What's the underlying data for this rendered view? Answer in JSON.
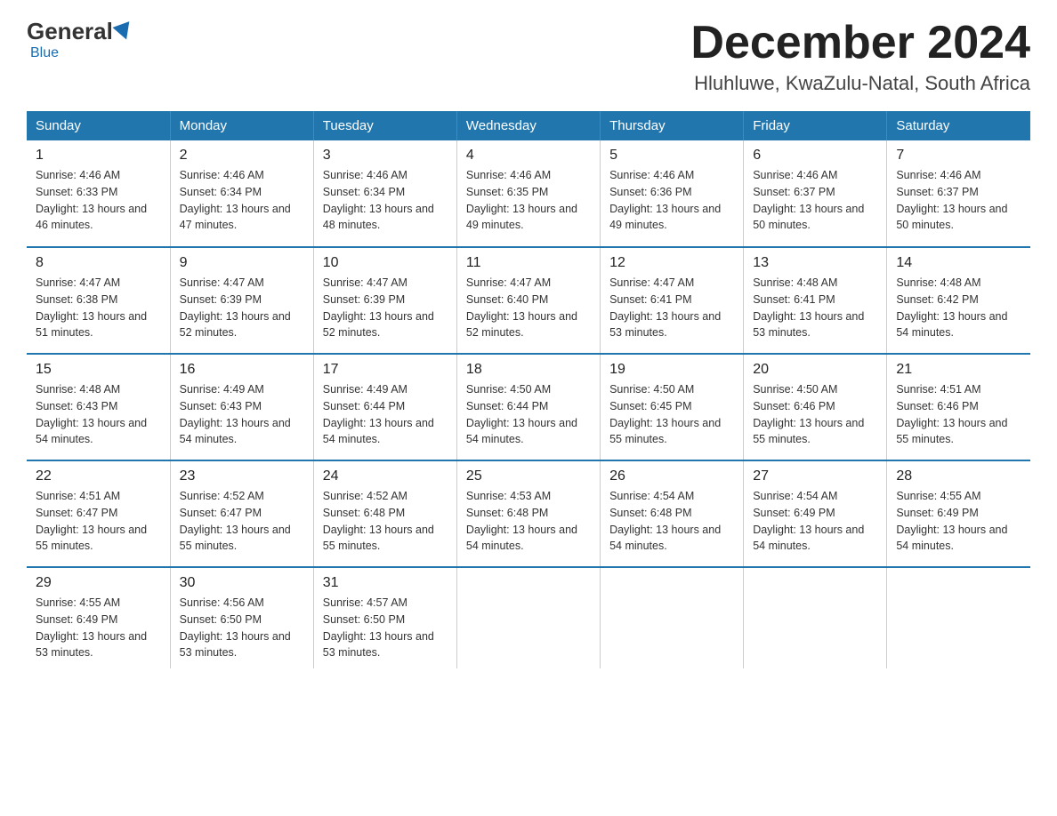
{
  "header": {
    "logo_general": "General",
    "logo_blue": "Blue",
    "month_title": "December 2024",
    "location": "Hluhluwe, KwaZulu-Natal, South Africa"
  },
  "days_of_week": [
    "Sunday",
    "Monday",
    "Tuesday",
    "Wednesday",
    "Thursday",
    "Friday",
    "Saturday"
  ],
  "weeks": [
    [
      {
        "day": "1",
        "sunrise": "4:46 AM",
        "sunset": "6:33 PM",
        "daylight": "13 hours and 46 minutes."
      },
      {
        "day": "2",
        "sunrise": "4:46 AM",
        "sunset": "6:34 PM",
        "daylight": "13 hours and 47 minutes."
      },
      {
        "day": "3",
        "sunrise": "4:46 AM",
        "sunset": "6:34 PM",
        "daylight": "13 hours and 48 minutes."
      },
      {
        "day": "4",
        "sunrise": "4:46 AM",
        "sunset": "6:35 PM",
        "daylight": "13 hours and 49 minutes."
      },
      {
        "day": "5",
        "sunrise": "4:46 AM",
        "sunset": "6:36 PM",
        "daylight": "13 hours and 49 minutes."
      },
      {
        "day": "6",
        "sunrise": "4:46 AM",
        "sunset": "6:37 PM",
        "daylight": "13 hours and 50 minutes."
      },
      {
        "day": "7",
        "sunrise": "4:46 AM",
        "sunset": "6:37 PM",
        "daylight": "13 hours and 50 minutes."
      }
    ],
    [
      {
        "day": "8",
        "sunrise": "4:47 AM",
        "sunset": "6:38 PM",
        "daylight": "13 hours and 51 minutes."
      },
      {
        "day": "9",
        "sunrise": "4:47 AM",
        "sunset": "6:39 PM",
        "daylight": "13 hours and 52 minutes."
      },
      {
        "day": "10",
        "sunrise": "4:47 AM",
        "sunset": "6:39 PM",
        "daylight": "13 hours and 52 minutes."
      },
      {
        "day": "11",
        "sunrise": "4:47 AM",
        "sunset": "6:40 PM",
        "daylight": "13 hours and 52 minutes."
      },
      {
        "day": "12",
        "sunrise": "4:47 AM",
        "sunset": "6:41 PM",
        "daylight": "13 hours and 53 minutes."
      },
      {
        "day": "13",
        "sunrise": "4:48 AM",
        "sunset": "6:41 PM",
        "daylight": "13 hours and 53 minutes."
      },
      {
        "day": "14",
        "sunrise": "4:48 AM",
        "sunset": "6:42 PM",
        "daylight": "13 hours and 54 minutes."
      }
    ],
    [
      {
        "day": "15",
        "sunrise": "4:48 AM",
        "sunset": "6:43 PM",
        "daylight": "13 hours and 54 minutes."
      },
      {
        "day": "16",
        "sunrise": "4:49 AM",
        "sunset": "6:43 PM",
        "daylight": "13 hours and 54 minutes."
      },
      {
        "day": "17",
        "sunrise": "4:49 AM",
        "sunset": "6:44 PM",
        "daylight": "13 hours and 54 minutes."
      },
      {
        "day": "18",
        "sunrise": "4:50 AM",
        "sunset": "6:44 PM",
        "daylight": "13 hours and 54 minutes."
      },
      {
        "day": "19",
        "sunrise": "4:50 AM",
        "sunset": "6:45 PM",
        "daylight": "13 hours and 55 minutes."
      },
      {
        "day": "20",
        "sunrise": "4:50 AM",
        "sunset": "6:46 PM",
        "daylight": "13 hours and 55 minutes."
      },
      {
        "day": "21",
        "sunrise": "4:51 AM",
        "sunset": "6:46 PM",
        "daylight": "13 hours and 55 minutes."
      }
    ],
    [
      {
        "day": "22",
        "sunrise": "4:51 AM",
        "sunset": "6:47 PM",
        "daylight": "13 hours and 55 minutes."
      },
      {
        "day": "23",
        "sunrise": "4:52 AM",
        "sunset": "6:47 PM",
        "daylight": "13 hours and 55 minutes."
      },
      {
        "day": "24",
        "sunrise": "4:52 AM",
        "sunset": "6:48 PM",
        "daylight": "13 hours and 55 minutes."
      },
      {
        "day": "25",
        "sunrise": "4:53 AM",
        "sunset": "6:48 PM",
        "daylight": "13 hours and 54 minutes."
      },
      {
        "day": "26",
        "sunrise": "4:54 AM",
        "sunset": "6:48 PM",
        "daylight": "13 hours and 54 minutes."
      },
      {
        "day": "27",
        "sunrise": "4:54 AM",
        "sunset": "6:49 PM",
        "daylight": "13 hours and 54 minutes."
      },
      {
        "day": "28",
        "sunrise": "4:55 AM",
        "sunset": "6:49 PM",
        "daylight": "13 hours and 54 minutes."
      }
    ],
    [
      {
        "day": "29",
        "sunrise": "4:55 AM",
        "sunset": "6:49 PM",
        "daylight": "13 hours and 53 minutes."
      },
      {
        "day": "30",
        "sunrise": "4:56 AM",
        "sunset": "6:50 PM",
        "daylight": "13 hours and 53 minutes."
      },
      {
        "day": "31",
        "sunrise": "4:57 AM",
        "sunset": "6:50 PM",
        "daylight": "13 hours and 53 minutes."
      },
      null,
      null,
      null,
      null
    ]
  ]
}
